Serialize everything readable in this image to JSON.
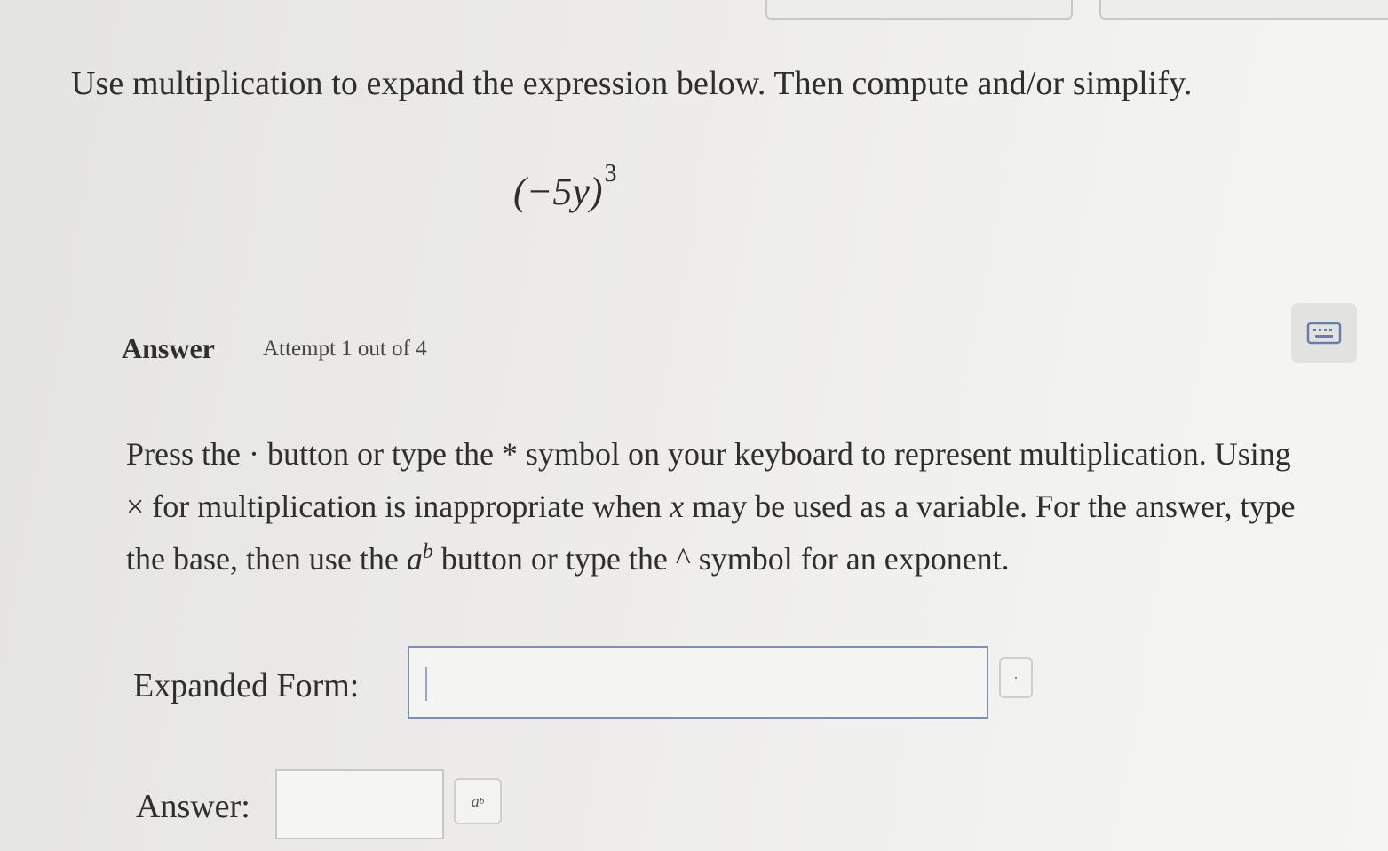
{
  "question": {
    "prompt": "Use multiplication to expand the expression below. Then compute and/or simplify.",
    "expression_base": "(−5y)",
    "expression_exponent": "3"
  },
  "answer_section": {
    "heading": "Answer",
    "attempt": "Attempt 1 out of 4",
    "keyboard_icon": "keyboard-icon"
  },
  "instructions": {
    "part1": "Press the · button or type the * symbol on your keyboard to represent multiplication. Using × for multiplication is inappropriate when ",
    "var_x": "x",
    "part2": " may be used as a variable. For the answer, type the base, then use the ",
    "power_base": "a",
    "power_exp": "b",
    "part3": " button or type the ^ symbol for an exponent."
  },
  "expanded_form": {
    "label": "Expanded Form:",
    "value": "",
    "dot_button_label": "·"
  },
  "answer": {
    "label": "Answer:",
    "value": "",
    "power_button_base": "a",
    "power_button_exp": "b"
  }
}
